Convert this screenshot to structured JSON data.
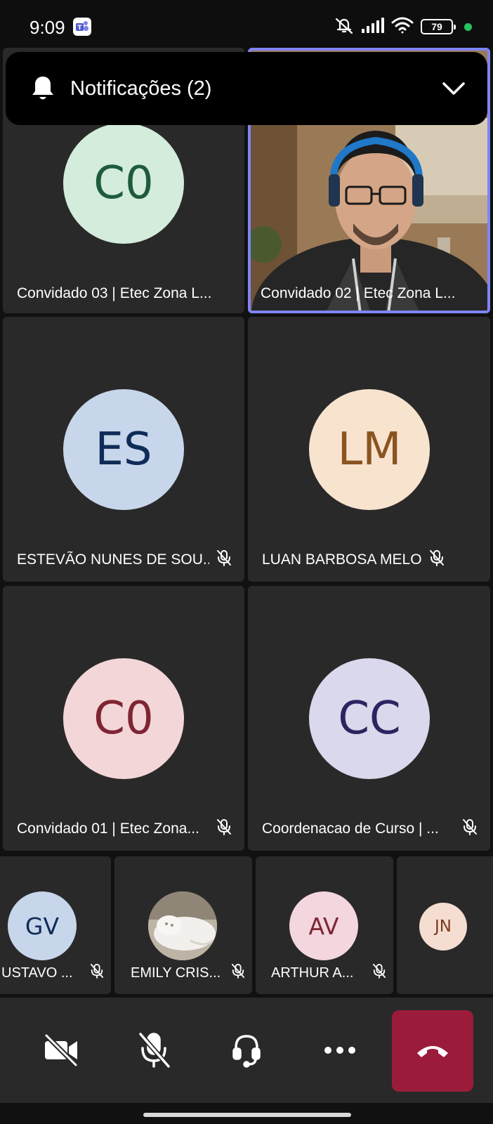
{
  "status_bar": {
    "time": "9:09",
    "battery": "79"
  },
  "notification": {
    "label": "Notificações (2)"
  },
  "participants": [
    {
      "initials": "C0",
      "name": "Convidado 03 | Etec Zona L...",
      "avatar_bg": "#d3ecdc",
      "avatar_fg": "#1e5b3a",
      "muted": false
    },
    {
      "name": "Convidado 02 | Etec Zona L...",
      "video": true,
      "muted": false
    },
    {
      "initials": "ES",
      "name": "ESTEVÃO NUNES DE SOU...",
      "avatar_bg": "#c7d6ea",
      "avatar_fg": "#0f2c58",
      "muted": true
    },
    {
      "initials": "LM",
      "name": "LUAN BARBOSA MELO",
      "avatar_bg": "#f8e3cf",
      "avatar_fg": "#8a5420",
      "muted": true
    },
    {
      "initials": "C0",
      "name": "Convidado 01 | Etec Zona...",
      "avatar_bg": "#f3d6d8",
      "avatar_fg": "#7e2533",
      "muted": true
    },
    {
      "initials": "CC",
      "name": "Coordenacao de Curso | ...",
      "avatar_bg": "#d9d8ec",
      "avatar_fg": "#2a2460",
      "muted": true
    }
  ],
  "small_participants": [
    {
      "initials": "GV",
      "name": "USTAVO ...",
      "avatar_bg": "#c7d6ea",
      "avatar_fg": "#0f2c58",
      "muted": true
    },
    {
      "name": "EMILY CRIS...",
      "photo": true,
      "muted": true
    },
    {
      "initials": "AV",
      "name": "ARTHUR A...",
      "avatar_bg": "#f3d6de",
      "avatar_fg": "#7e2533",
      "muted": true
    },
    {
      "initials": "JN",
      "avatar_bg": "#f6ddd1",
      "avatar_fg": "#7a3a1c"
    }
  ],
  "controls": [
    "camera-off",
    "mic-off",
    "audio-device",
    "more-options",
    "hang-up"
  ],
  "colors": {
    "speaker_border": "#7f85f5",
    "hangup": "#9b1c3a",
    "tile": "#292929"
  }
}
